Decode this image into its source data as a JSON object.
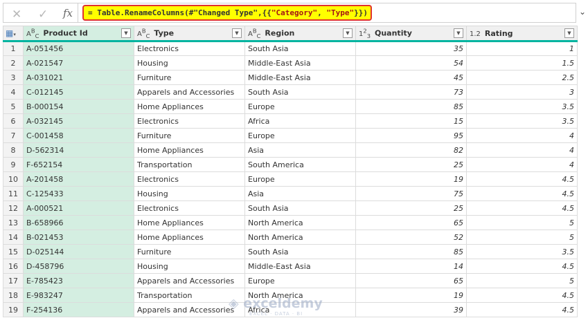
{
  "formula_bar": {
    "cancel_icon": "✕",
    "confirm_icon": "✓",
    "fx_label": "fx",
    "formula_prefix": "= Table.RenameColumns(#\"Changed Type\",{{",
    "arg1": "\"Category\"",
    "mid": ", ",
    "arg2": "\"Type\"",
    "suffix": "}})",
    "expand_icon": "⌄"
  },
  "columns": [
    {
      "name": "Product Id",
      "type_icon": "ABC"
    },
    {
      "name": "Type",
      "type_icon": "ABC"
    },
    {
      "name": "Region",
      "type_icon": "ABC"
    },
    {
      "name": "Quantity",
      "type_icon": "123"
    },
    {
      "name": "Rating",
      "type_icon": "1.2"
    }
  ],
  "rows": [
    [
      "1",
      "A-051456",
      "Electronics",
      "South Asia",
      "35",
      "1"
    ],
    [
      "2",
      "A-021547",
      "Housing",
      "Middle-East Asia",
      "54",
      "1.5"
    ],
    [
      "3",
      "A-031021",
      "Furniture",
      "Middle-East Asia",
      "45",
      "2.5"
    ],
    [
      "4",
      "C-012145",
      "Apparels and Accessories",
      "South Asia",
      "73",
      "3"
    ],
    [
      "5",
      "B-000154",
      "Home Appliances",
      "Europe",
      "85",
      "3.5"
    ],
    [
      "6",
      "A-032145",
      "Electronics",
      "Africa",
      "15",
      "3.5"
    ],
    [
      "7",
      "C-001458",
      "Furniture",
      "Europe",
      "95",
      "4"
    ],
    [
      "8",
      "D-562314",
      "Home Appliances",
      "Asia",
      "82",
      "4"
    ],
    [
      "9",
      "F-652154",
      "Transportation",
      "South America",
      "25",
      "4"
    ],
    [
      "10",
      "A-201458",
      "Electronics",
      "Europe",
      "19",
      "4.5"
    ],
    [
      "11",
      "C-125433",
      "Housing",
      "Asia",
      "75",
      "4.5"
    ],
    [
      "12",
      "A-000521",
      "Electronics",
      "South Asia",
      "25",
      "4.5"
    ],
    [
      "13",
      "B-658966",
      "Home Appliances",
      "North America",
      "65",
      "5"
    ],
    [
      "14",
      "B-021453",
      "Home Appliances",
      "North America",
      "52",
      "5"
    ],
    [
      "15",
      "D-025144",
      "Furniture",
      "South Asia",
      "85",
      "3.5"
    ],
    [
      "16",
      "D-458796",
      "Housing",
      "Middle-East Asia",
      "14",
      "4.5"
    ],
    [
      "17",
      "E-785423",
      "Apparels and Accessories",
      "Europe",
      "65",
      "5"
    ],
    [
      "18",
      "E-983247",
      "Transportation",
      "North America",
      "19",
      "4.5"
    ],
    [
      "19",
      "F-254136",
      "Apparels and Accessories",
      "Africa",
      "39",
      "4.5"
    ]
  ],
  "watermark": {
    "title": "exceldemy",
    "subtitle": "EXCEL · DATA · BI"
  }
}
